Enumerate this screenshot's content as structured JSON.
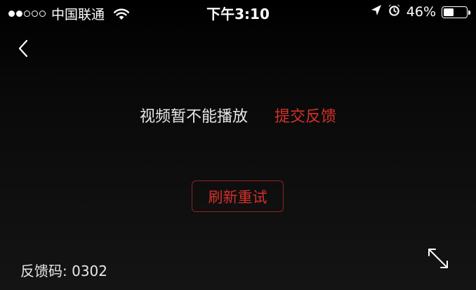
{
  "status_bar": {
    "signal_filled": 2,
    "signal_total": 5,
    "carrier": "中国联通",
    "time": "下午3:10",
    "battery_percent_label": "46%",
    "battery_level": 0.46,
    "icons": [
      "wifi-icon",
      "location-arrow-icon",
      "alarm-clock-icon",
      "battery-icon"
    ]
  },
  "nav": {
    "back_icon": "chevron-left-icon"
  },
  "player": {
    "error_message": "视频暂不能播放",
    "feedback_link": "提交反馈",
    "retry_label": "刷新重试",
    "feedback_code": "反馈码: 0302",
    "fullscreen_icon": "expand-diagonal-icon"
  },
  "colors": {
    "accent": "#d5302b",
    "retry_border": "#8e2420",
    "text": "#e8e8e8",
    "background": "#000000"
  }
}
